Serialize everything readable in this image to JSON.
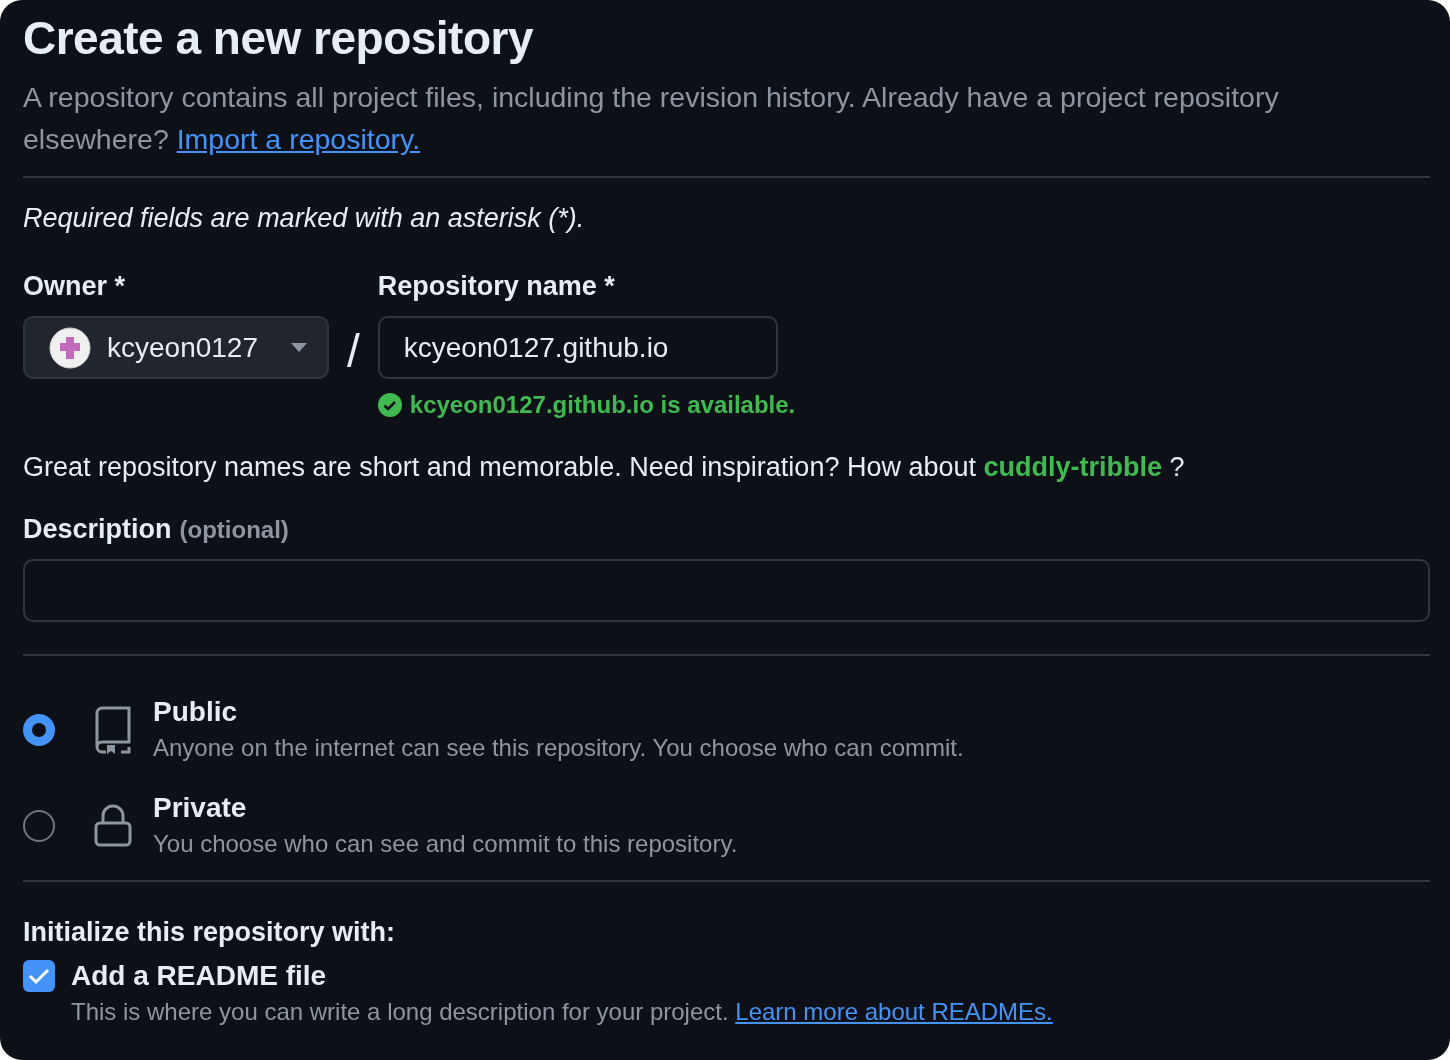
{
  "title": "Create a new repository",
  "intro": {
    "text": "A repository contains all project files, including the revision history. Already have a project repository elsewhere?",
    "link": "Import a repository."
  },
  "required_note": "Required fields are marked with an asterisk (*).",
  "owner": {
    "label": "Owner *",
    "value": "kcyeon0127"
  },
  "separator": "/",
  "repo_name": {
    "label": "Repository name *",
    "value": "kcyeon0127.github.io",
    "status": "kcyeon0127.github.io is available."
  },
  "suggestion": {
    "text": "Great repository names are short and memorable. Need inspiration? How about",
    "name": "cuddly-tribble",
    "end": "?"
  },
  "description": {
    "label": "Description",
    "hint": "(optional)"
  },
  "visibility": [
    {
      "kind": "public",
      "title": "Public",
      "text": "Anyone on the internet can see this repository. You choose who can commit.",
      "selected": true
    },
    {
      "kind": "private",
      "title": "Private",
      "text": "You choose who can see and commit to this repository.",
      "selected": false
    }
  ],
  "initialize": {
    "heading": "Initialize this repository with:",
    "options": [
      {
        "label": "Add a README file",
        "text": "This is where you can write a long description for your project.",
        "link": "Learn more about READMEs.",
        "checked": true
      }
    ]
  }
}
